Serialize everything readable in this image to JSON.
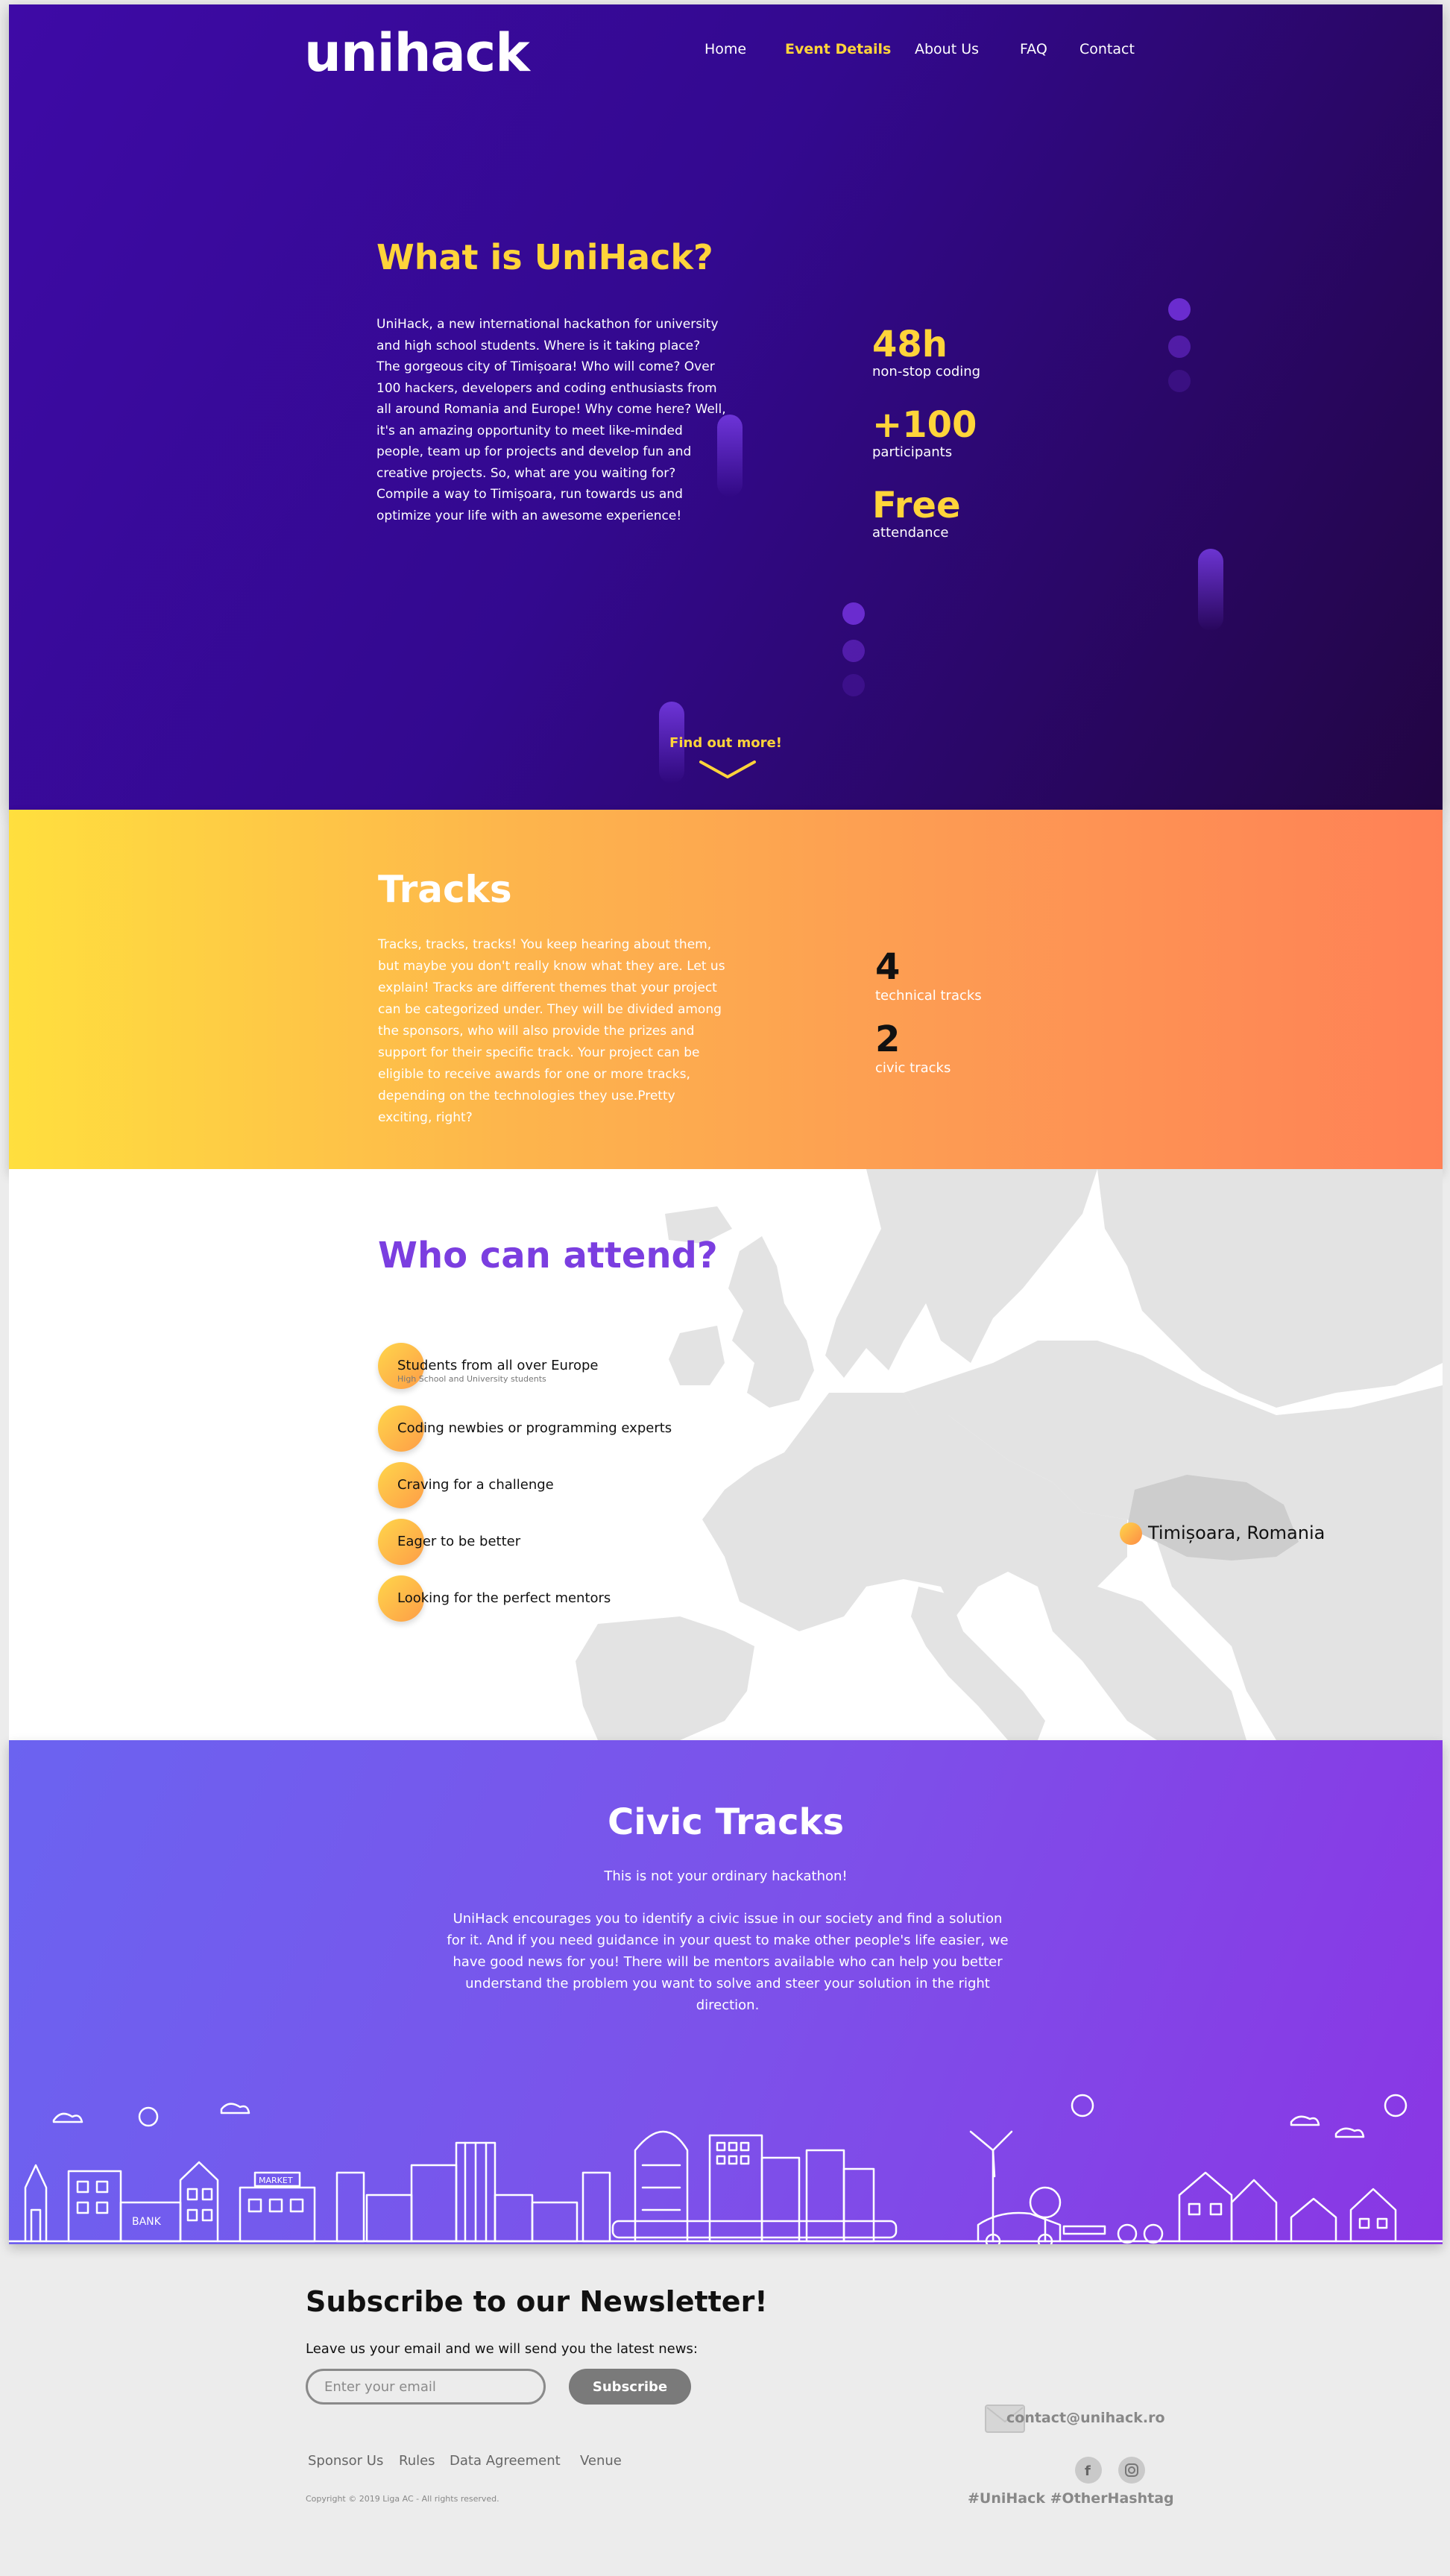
{
  "brand": {
    "logo_text": "unihack"
  },
  "nav": {
    "items": [
      {
        "label": "Home"
      },
      {
        "label": "Event Details"
      },
      {
        "label": "About Us"
      },
      {
        "label": "FAQ"
      },
      {
        "label": "Contact"
      }
    ],
    "active": "Event Details"
  },
  "hero": {
    "title": "What is UniHack?",
    "text": "UniHack, a new international hackathon for university and high school students. Where is it taking place? The gorgeous city of Timișoara! Who will come? Over 100 hackers, developers and coding enthusiasts from all around Romania and Europe! Why come here? Well, it's an amazing opportunity to meet like-minded people, team up for projects and develop fun and creative projects. So, what are you waiting for? Compile a way to Timișoara, run towards us and optimize your life with an awesome experience!",
    "stats": [
      {
        "value": "48h",
        "label": "non-stop coding"
      },
      {
        "value": "+100",
        "label": "participants"
      },
      {
        "value": "Free",
        "label": "attendance"
      }
    ],
    "find_more": "Find out more!"
  },
  "tracks": {
    "title": "Tracks",
    "text": "Tracks, tracks, tracks! You keep hearing about them, but maybe you don't really know what they are. Let us explain! Tracks are different themes that your project can be categorized under. They will be divided among the sponsors, who will also provide the prizes and support for their specific track. Your project can be eligible to receive awards for one or more tracks, depending on the technologies they use.Pretty exciting, right?",
    "stats": [
      {
        "value": "4",
        "label": "technical tracks"
      },
      {
        "value": "2",
        "label": "civic tracks"
      }
    ]
  },
  "attend": {
    "title": "Who can attend?",
    "items": [
      {
        "label": "Students from all over Europe",
        "sub": "High School and University students"
      },
      {
        "label": "Coding newbies or programming experts",
        "sub": ""
      },
      {
        "label": "Craving for a challenge",
        "sub": ""
      },
      {
        "label": "Eager to be better",
        "sub": ""
      },
      {
        "label": "Looking for the perfect mentors",
        "sub": ""
      }
    ],
    "location": "Timișoara, Romania"
  },
  "civic": {
    "title": "Civic Tracks",
    "subtitle": "This is not your ordinary hackathon!",
    "text": "UniHack encourages you to identify a civic issue in our society and find a solution for it. And if you need guidance in your quest to make other people's life easier, we have good news for you! There will be mentors available who can help you better understand the problem you want to solve and steer your solution in the right direction.",
    "bank_label": "BANK",
    "market_label": "MARKET"
  },
  "footer": {
    "newsletter_title": "Subscribe to our Newsletter!",
    "newsletter_sub": "Leave us your email and we will send you the latest news:",
    "email_placeholder": "Enter your email",
    "subscribe_label": "Subscribe",
    "links": [
      "Sponsor Us",
      "Rules",
      "Data Agreement",
      "Venue"
    ],
    "copyright": "Copyright © 2019 Liga AC - All rights reserved.",
    "contact_email": "contact@unihack.ro",
    "hashtags": "#UniHack #OtherHashtag"
  },
  "colors": {
    "hero_bg": "#3e0aa6",
    "accent_yellow": "#ffd43a",
    "tracks_start": "#ffdf3e",
    "tracks_end": "#ff8156",
    "purple_title": "#7b3ee0",
    "civic_bg": "#7c52ea",
    "footer_bg": "#ececec"
  },
  "icons": [
    "envelope-icon",
    "facebook-icon",
    "instagram-icon",
    "chevron-down-icon"
  ]
}
